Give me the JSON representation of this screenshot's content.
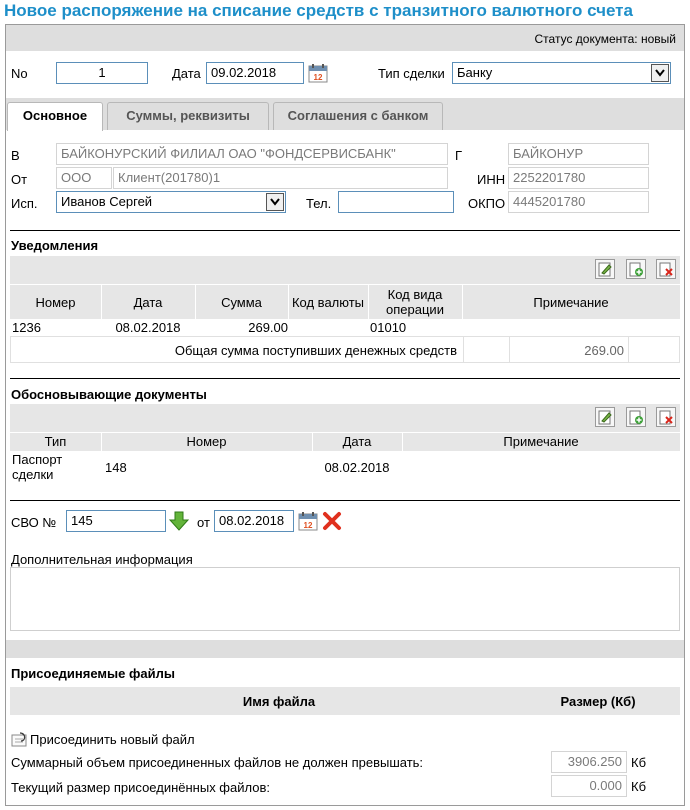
{
  "title": "Новое распоряжение на списание средств с транзитного валютного счета",
  "status": {
    "label": "Статус документа:",
    "value": "новый"
  },
  "header": {
    "no_label": "No",
    "no_value": "1",
    "date_label": "Дата",
    "date_value": "09.02.2018",
    "deal_type_label": "Тип сделки",
    "deal_type_value": "Банку"
  },
  "tabs": [
    "Основное",
    "Суммы, реквизиты",
    "Соглашения с банком"
  ],
  "bank": {
    "b_label": "В",
    "b_value": "БАЙКОНУРСКИЙ ФИЛИАЛ ОАО \"ФОНДСЕРВИСБАНК\"",
    "city_label": "Г",
    "city_value": "БАЙКОНУР",
    "from_label": "От",
    "from_type": "ООО",
    "from_value": "Клиент(201780)1",
    "inn_label": "ИНН",
    "inn_value": "2252201780",
    "exec_label": "Исп.",
    "exec_value": "Иванов Сергей",
    "tel_label": "Тел.",
    "tel_value": "",
    "okpo_label": "ОКПО",
    "okpo_value": "4445201780"
  },
  "notifications": {
    "title": "Уведомления",
    "columns": [
      "Номер",
      "Дата",
      "Сумма",
      "Код валюты",
      "Код вида операции",
      "Примечание"
    ],
    "rows": [
      {
        "number": "1236",
        "date": "08.02.2018",
        "sum": "269.00",
        "currency": "",
        "op_code": "01010",
        "note": ""
      }
    ],
    "total_label": "Общая сумма поступивших денежных средств",
    "total_value": "269.00"
  },
  "documents": {
    "title": "Обосновывающие документы",
    "columns": [
      "Тип",
      "Номер",
      "Дата",
      "Примечание"
    ],
    "rows": [
      {
        "type": "Паспорт сделки",
        "number": "148",
        "date": "08.02.2018",
        "note": ""
      }
    ]
  },
  "svo": {
    "label": "СВО №",
    "value": "145",
    "from_label": "от",
    "date_value": "08.02.2018"
  },
  "additional": {
    "label": "Дополнительная информация",
    "value": ""
  },
  "files": {
    "title": "Присоединяемые файлы",
    "col_name": "Имя файла",
    "col_size": "Размер (Кб)",
    "attach_label": "Присоединить новый файл",
    "limit_label": "Суммарный объем присоединенных файлов не должен превышать:",
    "limit_value": "3906.250",
    "current_label": "Текущий размер присоединённых файлов:",
    "current_value": "0.000",
    "unit": "Кб"
  },
  "icons": {
    "calendar": "calendar-icon",
    "edit": "edit-icon",
    "add": "add-icon",
    "delete": "delete-icon",
    "arrow": "arrow-down-icon",
    "clear": "clear-icon",
    "attach": "attach-icon"
  },
  "colors": {
    "title": "#1e8fc9",
    "panel": "#dedede",
    "field_border": "#5b8fb9"
  }
}
